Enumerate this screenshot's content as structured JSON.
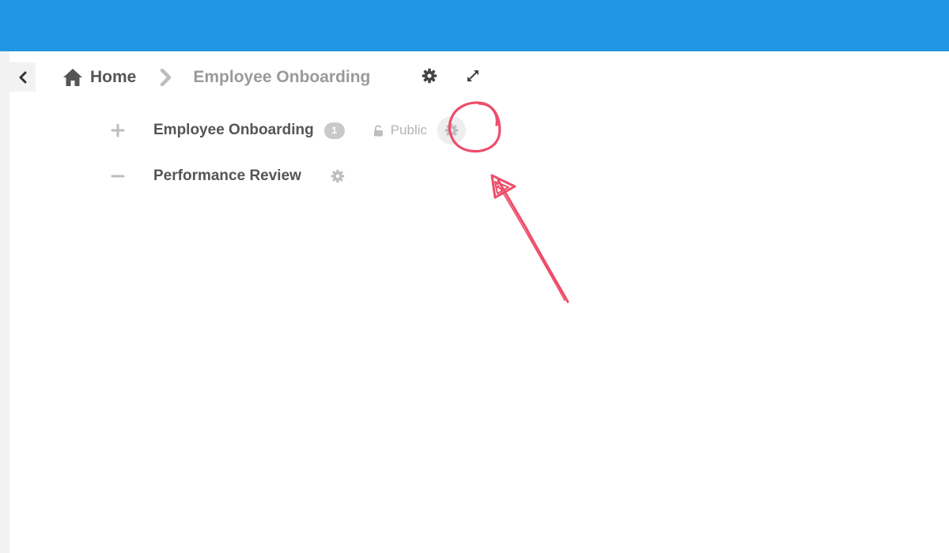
{
  "header": {
    "color": "#2196e3"
  },
  "nav": {
    "back_icon": "chevron-left-icon"
  },
  "breadcrumb": {
    "home_icon": "home-icon",
    "home_label": "Home",
    "separator_icon": "chevron-right-icon",
    "current_label": "Employee Onboarding",
    "settings_icon": "gear-icon",
    "expand_icon": "expand-icon"
  },
  "tree": {
    "items": [
      {
        "toggle": "+",
        "toggle_icon": "plus-icon",
        "name": "Employee Onboarding",
        "count": "1",
        "visibility": "Public",
        "visibility_icon": "unlock-icon",
        "settings_icon": "gear-icon"
      },
      {
        "toggle": "−",
        "toggle_icon": "minus-icon",
        "name": "Performance Review",
        "settings_icon": "gear-icon"
      }
    ]
  },
  "annotation": {
    "color": "#ee4d6a",
    "shapes": [
      "circle",
      "arrow"
    ]
  }
}
